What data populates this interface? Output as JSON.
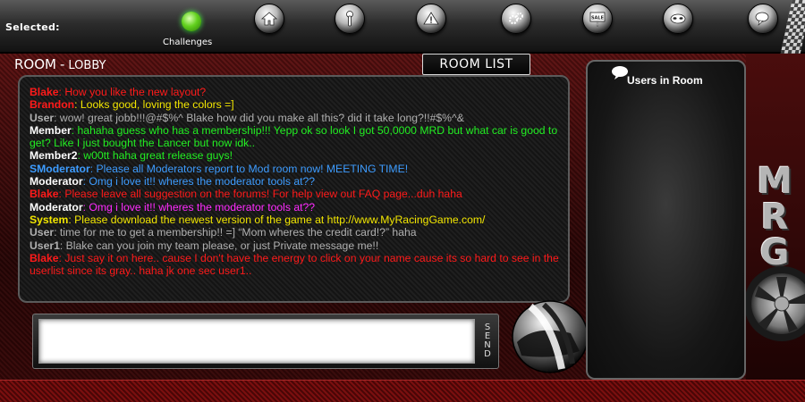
{
  "toolbar": {
    "selected_label": "Selected:",
    "challenges_label": "Challenges",
    "buttons": [
      {
        "icon": "home-icon"
      },
      {
        "icon": "wrench-icon"
      },
      {
        "icon": "warning-icon"
      },
      {
        "icon": "gears-icon"
      },
      {
        "icon": "sale-sign-icon",
        "text": "SALE"
      },
      {
        "icon": "mask-icon"
      },
      {
        "icon": "chat-bubbles-icon"
      }
    ]
  },
  "room": {
    "label": "ROOM",
    "separator": "-",
    "name": "LOBBY",
    "room_list_label": "ROOM LIST"
  },
  "colors": {
    "red": "#ff1a1a",
    "yellow": "#f2e600",
    "gray": "#b0b0b0",
    "green": "#22ee22",
    "blue": "#3d9cff",
    "white": "#ffffff",
    "magenta": "#ff2bff",
    "accent_red": "#5c1111"
  },
  "chat": {
    "messages": [
      {
        "user": "Blake",
        "sep": ": ",
        "text": "How you like the new layout?",
        "user_color": "red",
        "text_color": "red"
      },
      {
        "user": "Brandon",
        "sep": ": ",
        "text": "Looks good, loving the colors =]",
        "user_color": "red",
        "text_color": "yellow"
      },
      {
        "user": "User",
        "sep": ": ",
        "text": "wow! great jobb!!!@#$%^ Blake how did you make all this? did it take long?!!#$%^&",
        "user_color": "gray",
        "text_color": "gray"
      },
      {
        "user": "Member",
        "sep": ": ",
        "text": "hahaha guess who has a membership!!! Yepp ok so look I got 50,0000 MRD but what car is good to get? Like I just bought the Lancer but now idk..",
        "user_color": "white",
        "text_color": "green"
      },
      {
        "user": "Member2",
        "sep": ": ",
        "text": "w00tt haha great release guys!",
        "user_color": "white",
        "text_color": "green"
      },
      {
        "user": "SModerator",
        "sep": ": ",
        "text": "Please all Moderators report to Mod room now! MEETING TIME!",
        "user_color": "blue",
        "text_color": "blue"
      },
      {
        "user": "Moderator",
        "sep": ": ",
        "text": "Omg i love it!! wheres the moderator tools at??",
        "user_color": "white",
        "text_color": "blue"
      },
      {
        "user": "Blake",
        "sep": ": ",
        "text": "Please leave all suggestion on the forums! For help view out FAQ page...duh haha",
        "user_color": "red",
        "text_color": "red"
      },
      {
        "user": "Moderator",
        "sep": ": ",
        "text": "Omg i love it!! wheres the moderator tools at??",
        "user_color": "white",
        "text_color": "magenta"
      },
      {
        "user": "System",
        "sep": ": ",
        "text": "Please download the newest version of the game at http://www.MyRacingGame.com/",
        "user_color": "yellow",
        "text_color": "yellow"
      },
      {
        "user": "User",
        "sep": ": ",
        "text": "time for me to get a membership!! =] “Mom wheres the credit card!?” haha",
        "user_color": "gray",
        "text_color": "gray"
      },
      {
        "user": "User1",
        "sep": ": ",
        "text": "Blake can you join my team please, or just Private message me!!",
        "user_color": "gray",
        "text_color": "gray"
      },
      {
        "user": "Blake",
        "sep": ": ",
        "text": "Just say it on here.. cause I don't have the energy to click on your name cause its so hard to see in the userlist since its gray.. haha jk one sec user1..",
        "user_color": "red",
        "text_color": "red"
      }
    ],
    "input_value": "",
    "send_label": "SEND"
  },
  "users_panel": {
    "title": "Users in Room",
    "users": []
  },
  "branding": {
    "letters": [
      "M",
      "R",
      "G"
    ]
  }
}
